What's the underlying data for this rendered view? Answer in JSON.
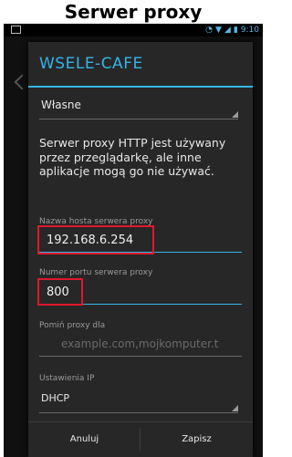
{
  "page_title": "Serwer proxy",
  "status_bar": {
    "time": "9:10",
    "alarm_icon": "alarm-icon",
    "wifi_icon": "wifi-icon",
    "signal_icon": "signal-icon",
    "battery_icon": "battery-icon"
  },
  "dialog": {
    "title": "WSELE-CAFE",
    "proxy_mode": "Własne",
    "proxy_description": "Serwer proxy HTTP jest używany przez przeglądarkę, ale inne aplikacje mogą go nie używać.",
    "host_label": "Nazwa hosta serwera proxy",
    "host_value": "192.168.6.254",
    "port_label": "Numer portu serwera proxy",
    "port_value": "800",
    "bypass_label": "Pomiń proxy dla",
    "bypass_placeholder": "example.com,mojkomputer.t",
    "ip_settings_label": "Ustawienia IP",
    "ip_settings_value": "DHCP",
    "cancel_label": "Anuluj",
    "save_label": "Zapisz"
  },
  "colors": {
    "accent": "#33b5e5",
    "highlight_box": "#e0182b"
  }
}
